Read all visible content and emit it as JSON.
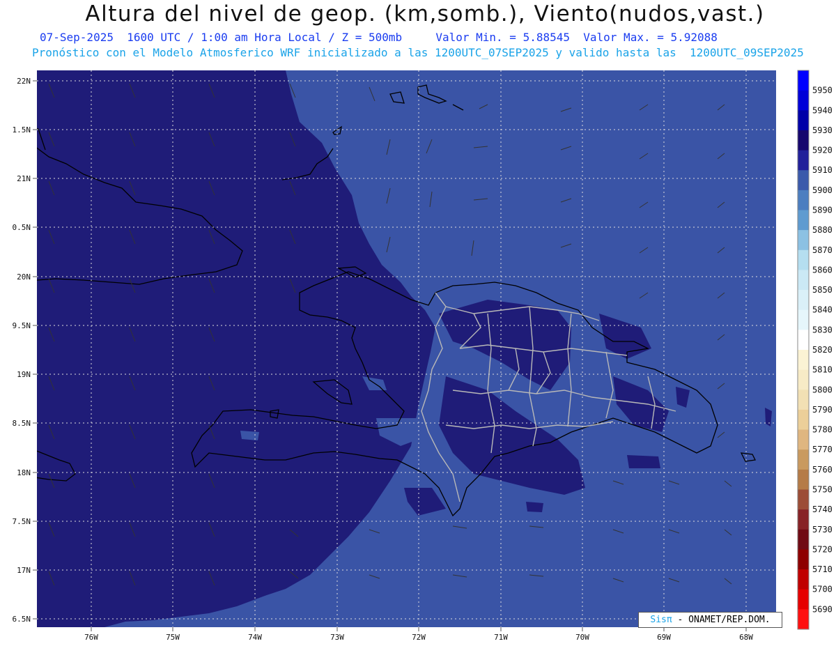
{
  "title": "Altura del nivel de geop. (km,somb.), Viento(nudos,vast.)",
  "subtitle_1": "07-Sep-2025  1600 UTC / 1:00 am Hora Local / Z = 500mb     Valor Min. = 5.88545  Valor Max. = 5.92088",
  "subtitle_2": "Pronóstico con el Modelo Atmosferico WRF inicializado a las 1200UTC_07SEP2025 y valido hasta las  1200UTC_09SEP2025",
  "lat_labels": [
    "22N",
    "1.5N",
    "21N",
    "0.5N",
    "20N",
    "9.5N",
    "19N",
    "8.5N",
    "18N",
    "7.5N",
    "17N",
    "6.5N"
  ],
  "lon_labels": [
    "76W",
    "75W",
    "74W",
    "73W",
    "72W",
    "71W",
    "70W",
    "69W",
    "68W"
  ],
  "colorbar": {
    "levels": [
      "5950",
      "5940",
      "5930",
      "5920",
      "5910",
      "5900",
      "5890",
      "5880",
      "5870",
      "5860",
      "5850",
      "5840",
      "5830",
      "5820",
      "5810",
      "5800",
      "5790",
      "5780",
      "5770",
      "5760",
      "5750",
      "5740",
      "5730",
      "5720",
      "5710",
      "5700",
      "5690"
    ],
    "colors": [
      "#0000ff",
      "#0000d8",
      "#0000a8",
      "#16066e",
      "#21209a",
      "#3b5aab",
      "#4c7ec0",
      "#5f9bd0",
      "#8cc1e3",
      "#b5def0",
      "#cbe9f5",
      "#daf0f8",
      "#e6f6fb",
      "#ffffff",
      "#fbf3d4",
      "#f7ebc6",
      "#f2e0b4",
      "#eccf99",
      "#dfb680",
      "#c99a5f",
      "#b57b47",
      "#9c4d36",
      "#872226",
      "#700a14",
      "#8e0000",
      "#c00000",
      "#e60000",
      "#ff1010"
    ]
  },
  "colors": {
    "dark_fill": "#1f1c78",
    "light_fill": "#3a54a6",
    "grid": "#dddddd",
    "borders": "#b8b8b8"
  },
  "credit": {
    "sis": "Sisπ",
    "rest": "- ONAMET/REP.DOM."
  }
}
